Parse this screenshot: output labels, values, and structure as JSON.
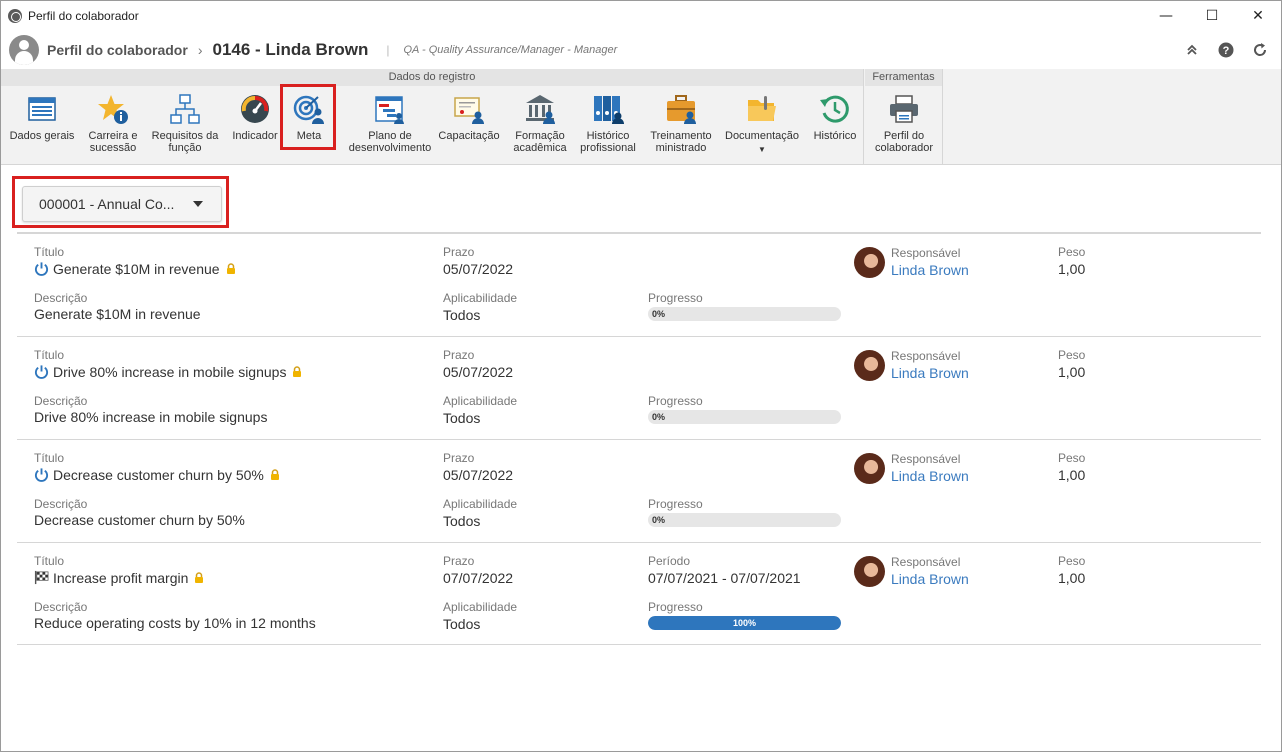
{
  "window": {
    "title": "Perfil do colaborador"
  },
  "header": {
    "section": "Perfil do colaborador",
    "employee": "0146 - Linda Brown",
    "position": "QA - Quality Assurance/Manager - Manager"
  },
  "ribbon": {
    "group_record": "Dados do registro",
    "group_tools": "Ferramentas",
    "buttons": [
      {
        "label": "Dados gerais",
        "icon": "form-icon"
      },
      {
        "label": "Carreira e sucessão",
        "icon": "star-info-icon"
      },
      {
        "label": "Requisitos da função",
        "icon": "org-chart-icon"
      },
      {
        "label": "Indicador",
        "icon": "gauge-icon"
      },
      {
        "label": "Meta",
        "icon": "target-person-icon"
      },
      {
        "label": "Plano de desenvolvimento",
        "icon": "gantt-icon"
      },
      {
        "label": "Capacitação",
        "icon": "certificate-icon"
      },
      {
        "label": "Formação acadêmica",
        "icon": "academy-icon"
      },
      {
        "label": "Histórico profissional",
        "icon": "binders-icon"
      },
      {
        "label": "Treinamento ministrado",
        "icon": "briefcase-icon"
      },
      {
        "label": "Documentação",
        "icon": "folder-icon"
      },
      {
        "label": "Histórico",
        "icon": "history-icon"
      },
      {
        "label": "Perfil do colaborador",
        "icon": "printer-icon"
      }
    ]
  },
  "selector": {
    "value": "000001 - Annual Co..."
  },
  "labels": {
    "title": "Título",
    "deadline": "Prazo",
    "responsible": "Responsável",
    "weight": "Peso",
    "description": "Descrição",
    "applicability": "Aplicabilidade",
    "progress": "Progresso",
    "period": "Período"
  },
  "goals": [
    {
      "title": "Generate $10M in revenue",
      "status_icon": "power-icon",
      "deadline": "05/07/2022",
      "period": "",
      "responsible": "Linda Brown",
      "weight": "1,00",
      "description": "Generate $10M in revenue",
      "applicability": "Todos",
      "progress_text": "0%",
      "progress": 0
    },
    {
      "title": "Drive 80% increase in mobile signups",
      "status_icon": "power-icon",
      "deadline": "05/07/2022",
      "period": "",
      "responsible": "Linda Brown",
      "weight": "1,00",
      "description": "Drive 80% increase in mobile signups",
      "applicability": "Todos",
      "progress_text": "0%",
      "progress": 0
    },
    {
      "title": "Decrease customer churn by 50%",
      "status_icon": "power-icon",
      "deadline": "05/07/2022",
      "period": "",
      "responsible": "Linda Brown",
      "weight": "1,00",
      "description": "Decrease customer churn by 50%",
      "applicability": "Todos",
      "progress_text": "0%",
      "progress": 0
    },
    {
      "title": "Increase profit margin",
      "status_icon": "checkered-flag-icon",
      "deadline": "07/07/2022",
      "period": "07/07/2021 - 07/07/2021",
      "responsible": "Linda Brown",
      "weight": "1,00",
      "description": "Reduce operating costs by 10% in 12 months",
      "applicability": "Todos",
      "progress_text": "100%",
      "progress": 100
    }
  ],
  "colors": {
    "accent": "#2e76bd",
    "highlight": "#d9201f",
    "link": "#3b7bbf"
  }
}
